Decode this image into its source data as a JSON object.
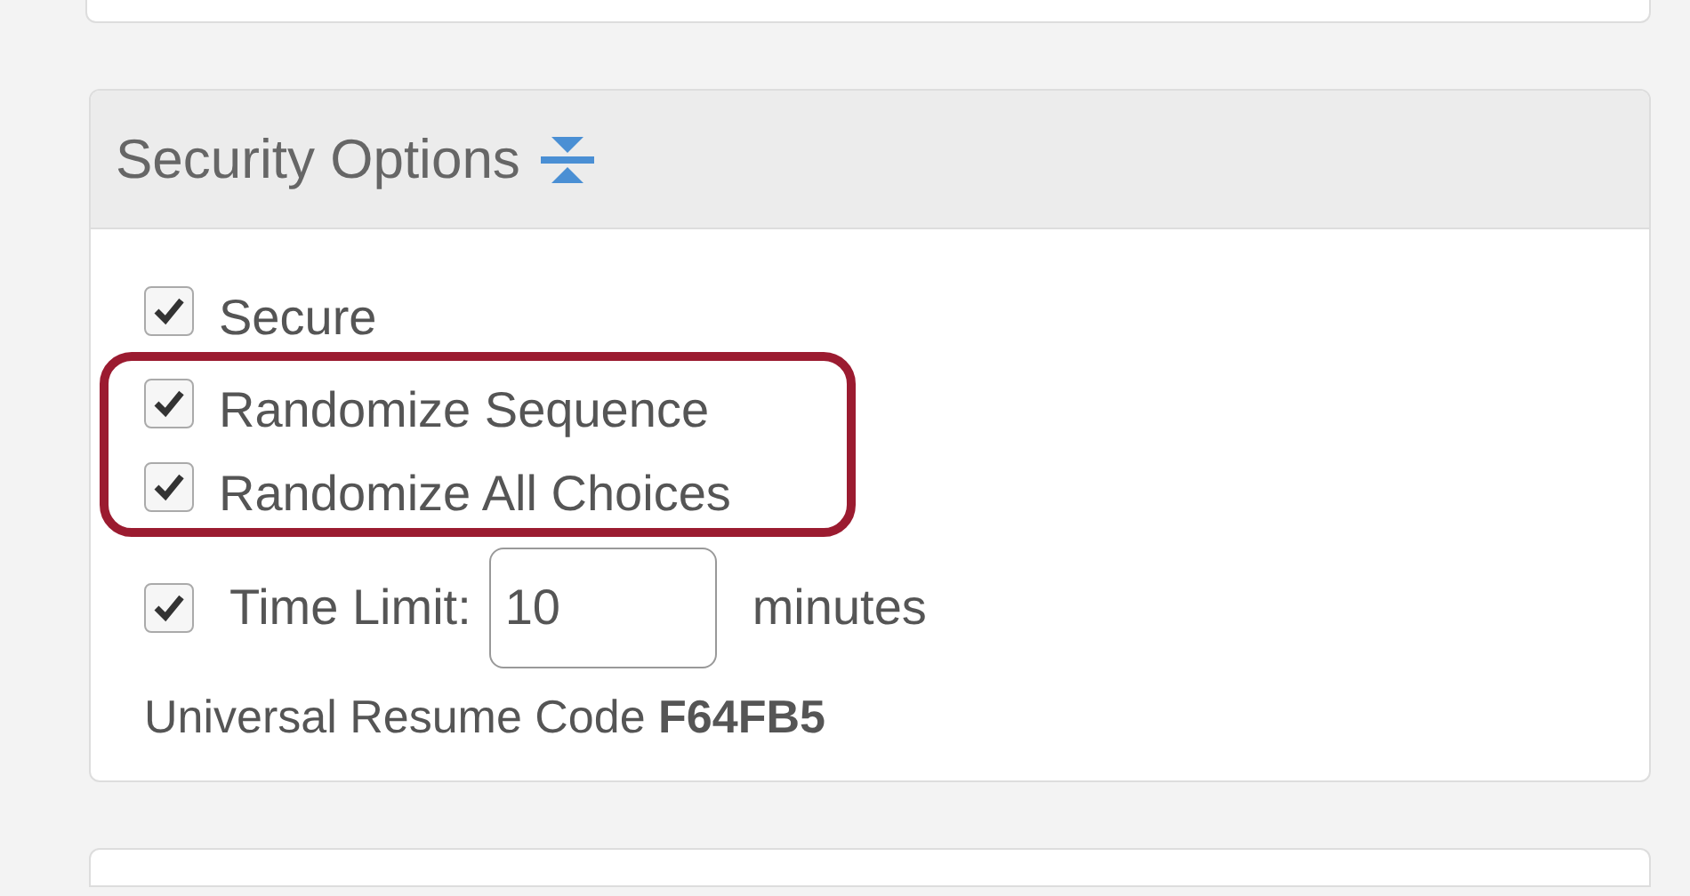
{
  "panel": {
    "title": "Security Options"
  },
  "options": [
    {
      "label": "Secure",
      "checked": true,
      "highlighted": false
    },
    {
      "label": "Randomize Sequence",
      "checked": true,
      "highlighted": true
    },
    {
      "label": "Randomize All Choices",
      "checked": true,
      "highlighted": true
    }
  ],
  "time_limit": {
    "checked": true,
    "label": "Time Limit:",
    "value": "10",
    "unit": "minutes"
  },
  "resume_code": {
    "label": "Universal Resume Code",
    "value": "F64FB5"
  }
}
